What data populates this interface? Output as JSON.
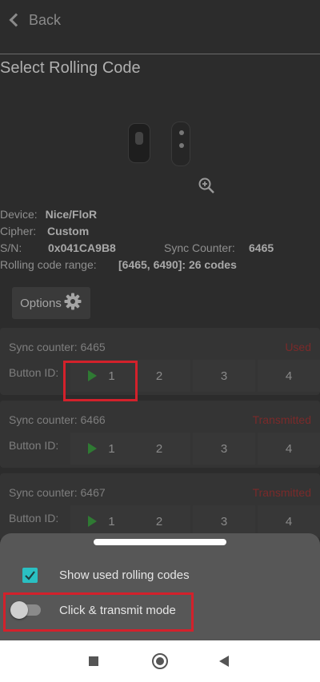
{
  "header": {
    "back_label": "Back"
  },
  "page_title": "Select Rolling Code",
  "device_info": {
    "device_label": "Device:",
    "device_value": "Nice/FloR",
    "cipher_label": "Cipher:",
    "cipher_value": "Custom",
    "sn_label": "S/N:",
    "sn_value": "0x041CA9B8",
    "sync_label": "Sync Counter:",
    "sync_value": "6465",
    "range_label": "Rolling code range:",
    "range_value": "[6465, 6490]: 26 codes"
  },
  "options_button": {
    "label": "Options",
    "icon": "gear-icon"
  },
  "codes": [
    {
      "sync_label": "Sync counter:",
      "sync_value": "6465",
      "status": "Used",
      "button_id_label": "Button ID:",
      "buttons": [
        "1",
        "2",
        "3",
        "4"
      ]
    },
    {
      "sync_label": "Sync counter:",
      "sync_value": "6466",
      "status": "Transmitted",
      "button_id_label": "Button ID:",
      "buttons": [
        "1",
        "2",
        "3",
        "4"
      ]
    },
    {
      "sync_label": "Sync counter:",
      "sync_value": "6467",
      "status": "Transmitted",
      "button_id_label": "Button ID:",
      "buttons": [
        "1",
        "2",
        "3",
        "4"
      ]
    }
  ],
  "bottom_sheet": {
    "show_used_label": "Show used rolling codes",
    "show_used_checked": true,
    "click_transmit_label": "Click & transmit mode",
    "click_transmit_on": false
  },
  "colors": {
    "accent": "#2ac0c2",
    "play": "#2f7a33",
    "highlight": "#d3212b",
    "status": "#7a2a2a"
  }
}
